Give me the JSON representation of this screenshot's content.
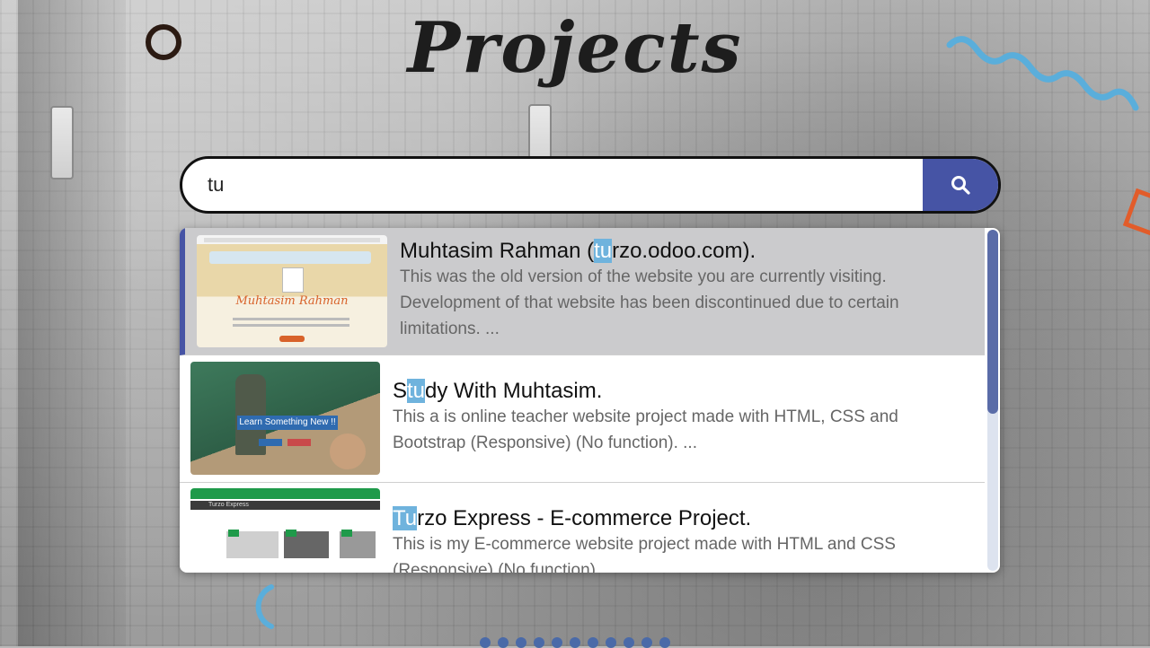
{
  "page": {
    "title": "Projects"
  },
  "search": {
    "value": "tu"
  },
  "results": [
    {
      "title_before": "Muhtasim Rahman (",
      "title_match": "tu",
      "title_after": "rzo.odoo.com).",
      "description": "This was the old version of the website you are currently visiting. Development of that website has been discontinued due to certain limitations. ...",
      "thumb_caption": "Muhtasim Rahman",
      "active": true
    },
    {
      "title_before": "S",
      "title_match": "tu",
      "title_after": "dy With Muhtasim.",
      "description": "This a is online teacher website project made with HTML, CSS and Bootstrap (Responsive) (No function). ...",
      "thumb_caption": "Learn Something New !!",
      "active": false
    },
    {
      "title_before": "",
      "title_match": "Tu",
      "title_after": "rzo Express - E-commerce Project.",
      "description": "This is my E-commerce website project made with HTML and CSS (Responsive) (No function). ...",
      "thumb_caption": "Turzo Express",
      "active": false
    }
  ],
  "colors": {
    "accent": "#4654a5",
    "highlight": "#6fb3dd"
  }
}
